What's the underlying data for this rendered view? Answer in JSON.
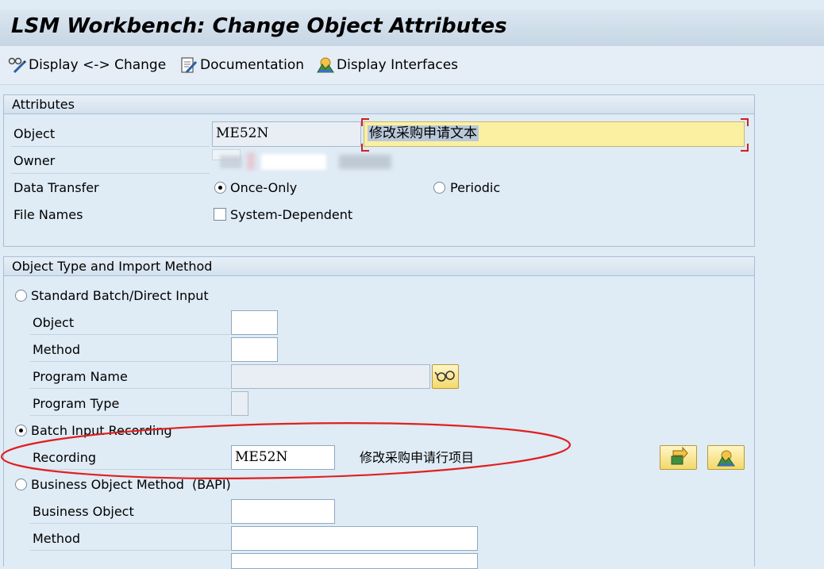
{
  "window": {
    "title": "LSM Workbench: Change Object Attributes"
  },
  "toolbar": {
    "display_change": "Display <-> Change",
    "documentation": "Documentation",
    "display_interfaces": "Display Interfaces"
  },
  "attributes": {
    "header": "Attributes",
    "object_label": "Object",
    "object_value": "ME52N",
    "object_description": "修改采购申请文本",
    "owner_label": "Owner",
    "data_transfer_label": "Data Transfer",
    "once_only": "Once-Only",
    "periodic": "Periodic",
    "data_transfer_selected": "Once-Only",
    "file_names_label": "File Names",
    "system_dependent": "System-Dependent",
    "system_dependent_checked": false
  },
  "import_method": {
    "header": "Object Type and Import Method",
    "standard_batch": "Standard Batch/Direct Input",
    "object_label": "Object",
    "method_label": "Method",
    "program_name_label": "Program Name",
    "program_type_label": "Program Type",
    "batch_input_recording": "Batch Input Recording",
    "recording_label": "Recording",
    "recording_value": "ME52N",
    "recording_description": "修改采购申请行项目",
    "bapi": "Business Object Method  (BAPI)",
    "business_object_label": "Business Object",
    "bapi_method_label": "Method",
    "selected": "Batch Input Recording"
  },
  "colors": {
    "annotation_ellipse": "#e02020",
    "highlight_field": "#fbefa2"
  }
}
